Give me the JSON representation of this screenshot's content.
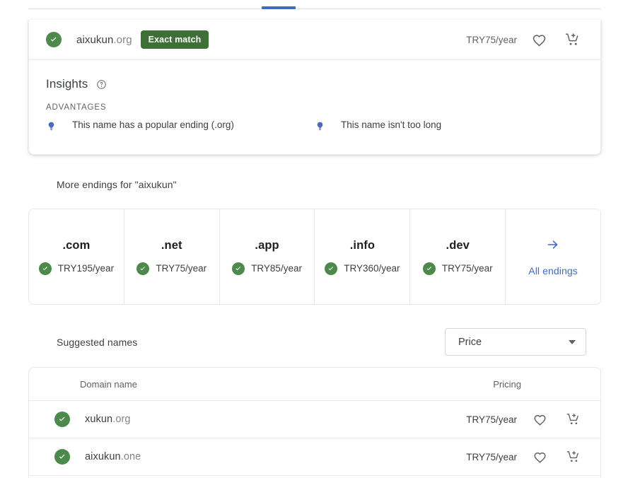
{
  "tabs": {
    "active_indicator": true,
    "accent_color": "#4169c9"
  },
  "exact_match": {
    "status_icon": "check-circle-icon",
    "domain_sld": "aixukun",
    "domain_tld": ".org",
    "badge_label": "Exact match",
    "badge_color": "#3e6f37",
    "price": "TRY75/year",
    "favorite_icon": "heart-icon",
    "cart_icon": "add-to-cart-icon"
  },
  "insights": {
    "title": "Insights",
    "help_icon": "help-circle-icon",
    "advantages_label": "ADVANTAGES",
    "advantages": [
      {
        "icon": "lightbulb-icon",
        "text": "This name has a popular ending (.org)"
      },
      {
        "icon": "lightbulb-icon",
        "text": "This name isn't too long"
      }
    ],
    "bulb_color": "#4a68c8"
  },
  "more_endings": {
    "title": "More endings for \"aixukun\"",
    "endings": [
      {
        "tld": ".com",
        "price": "TRY195/year",
        "available": true
      },
      {
        "tld": ".net",
        "price": "TRY75/year",
        "available": true
      },
      {
        "tld": ".app",
        "price": "TRY85/year",
        "available": true
      },
      {
        "tld": ".info",
        "price": "TRY360/year",
        "available": true
      },
      {
        "tld": ".dev",
        "price": "TRY75/year",
        "available": true
      }
    ],
    "all_endings_label": "All endings",
    "all_endings_icon": "arrow-right-icon",
    "link_color": "#4169c9"
  },
  "suggested": {
    "label": "Suggested names",
    "sort": {
      "value": "Price",
      "caret_icon": "chevron-down-icon",
      "options": [
        "Price"
      ]
    },
    "columns": {
      "domain": "Domain name",
      "pricing": "Pricing"
    },
    "rows": [
      {
        "status_icon": "check-circle-icon",
        "sld": "xukun",
        "tld": ".org",
        "price": "TRY75/year",
        "favorite_icon": "heart-icon",
        "cart_icon": "add-to-cart-icon"
      },
      {
        "status_icon": "check-circle-icon",
        "sld": "aixukun",
        "tld": ".one",
        "price": "TRY75/year",
        "favorite_icon": "heart-icon",
        "cart_icon": "add-to-cart-icon"
      }
    ]
  },
  "colors": {
    "available_green": "#4b8a4b",
    "text_primary": "#3c4043",
    "text_secondary": "#5f6368"
  }
}
